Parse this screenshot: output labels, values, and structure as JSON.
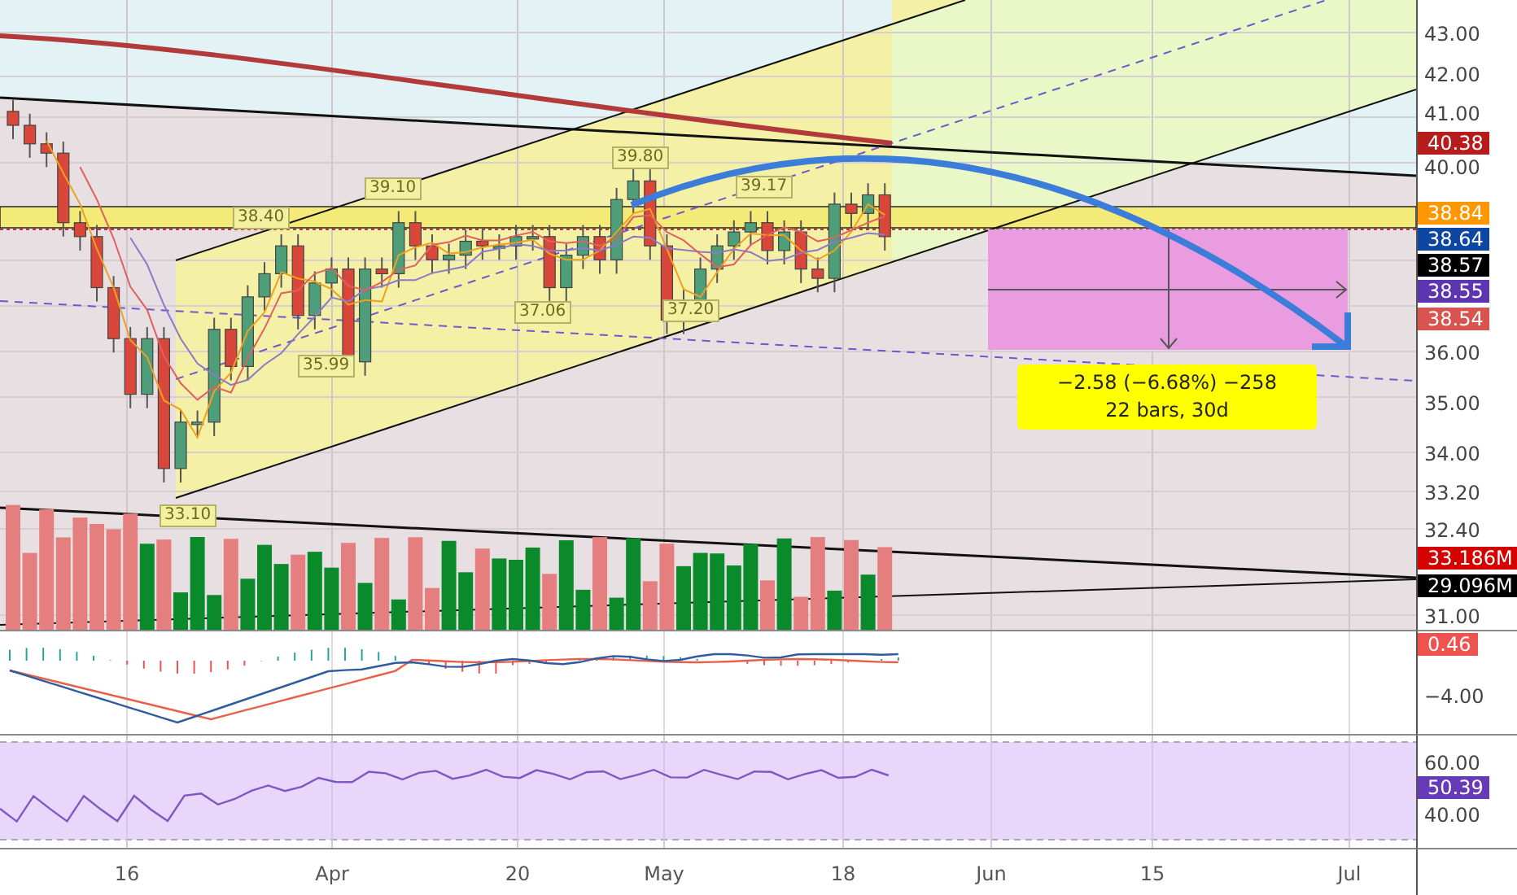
{
  "main_pane": {
    "price_axis": {
      "ticks": [
        "43.00",
        "42.00",
        "41.00",
        "40.00",
        "36.00",
        "35.00",
        "34.00",
        "33.20",
        "32.40",
        "31.00"
      ]
    },
    "price_tags": [
      {
        "text": "40.38",
        "color": "#b71c1c"
      },
      {
        "text": "38.84",
        "color": "#ff9800"
      },
      {
        "text": "38.64",
        "color": "#0d47a1"
      },
      {
        "text": "38.57",
        "color": "#000000"
      },
      {
        "text": "38.55",
        "color": "#5e35b1"
      },
      {
        "text": "38.54",
        "color": "#d9534f"
      }
    ],
    "volume_tags": [
      {
        "text": "33.186M",
        "color": "#d50000"
      },
      {
        "text": "29.096M",
        "color": "#000000"
      }
    ],
    "annotations": [
      "39.80",
      "39.10",
      "38.40",
      "39.17",
      "37.06",
      "35.99",
      "37.20",
      "33.10"
    ],
    "measure": {
      "line_1": "−2.58 (−6.68%) −258",
      "line_2": "22 bars, 30d"
    }
  },
  "macd_pane": {
    "ticks": [
      "−4.00"
    ],
    "tag": {
      "text": "0.46",
      "color": "#ef5350"
    }
  },
  "rsi_pane": {
    "ticks": [
      "60.00",
      "40.00"
    ],
    "tag": {
      "text": "50.39",
      "color": "#673ab7"
    }
  },
  "time_axis": {
    "labels": [
      "16",
      "Apr",
      "20",
      "May",
      "18",
      "Jun",
      "15",
      "Jul"
    ]
  }
}
